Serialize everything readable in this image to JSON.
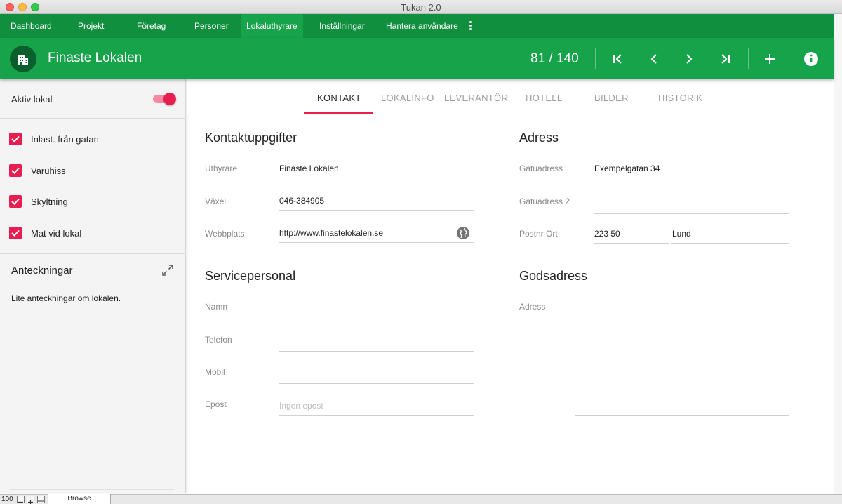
{
  "window": {
    "title": "Tukan 2.0"
  },
  "nav": {
    "items": [
      {
        "label": "Dashboard"
      },
      {
        "label": "Projekt"
      },
      {
        "label": "Företag"
      },
      {
        "label": "Personer"
      },
      {
        "label": "Lokaluthyrare",
        "active": true
      },
      {
        "label": "Inställningar"
      },
      {
        "label": "Hantera användare"
      }
    ],
    "more_icon": "more-vertical-icon"
  },
  "header": {
    "avatar_icon": "building-icon",
    "title": "Finaste Lokalen",
    "counter": "81 / 140",
    "buttons": [
      "first-page-icon",
      "previous-icon",
      "next-icon",
      "last-page-icon",
      "add-icon",
      "info-icon"
    ]
  },
  "sidebar": {
    "active_label": "Aktiv lokal",
    "active_on": true,
    "checkboxes": [
      {
        "label": "Inlast. från gatan",
        "checked": true
      },
      {
        "label": "Varuhiss",
        "checked": true
      },
      {
        "label": "Skyltning",
        "checked": true
      },
      {
        "label": "Mat vid lokal",
        "checked": true
      }
    ],
    "notes_title": "Anteckningar",
    "notes_text": "Lite anteckningar om lokalen."
  },
  "tabs": [
    {
      "label": "KONTAKT",
      "active": true
    },
    {
      "label": "LOKALINFO"
    },
    {
      "label": "LEVERANTÖR"
    },
    {
      "label": "HOTELL"
    },
    {
      "label": "BILDER"
    },
    {
      "label": "HISTORIK"
    }
  ],
  "contact": {
    "title": "Kontaktuppgifter",
    "landlord_label": "Uthyrare",
    "landlord_value": "Finaste Lokalen",
    "switchboard_label": "Växel",
    "switchboard_value": "046-384905",
    "website_label": "Webbplats",
    "website_value": "http://www.finastelokalen.se"
  },
  "service": {
    "title": "Servicepersonal",
    "name_label": "Namn",
    "name_value": "",
    "phone_label": "Telefon",
    "phone_value": "",
    "mobile_label": "Mobil",
    "mobile_value": "",
    "email_label": "Epost",
    "email_placeholder": "Ingen epost"
  },
  "address": {
    "title": "Adress",
    "street_label": "Gatuadress",
    "street_value": "Exempelgatan 34",
    "street2_label": "Gatuadress 2",
    "street2_value": "",
    "postal_label": "Postnr Ort",
    "postal_code": "223 50",
    "city": "Lund"
  },
  "goods": {
    "title": "Godsadress",
    "address_label": "Adress",
    "address_value": ""
  },
  "statusbar": {
    "zoom": "100",
    "mode": "Browse"
  },
  "colors": {
    "nav": "#10903f",
    "header": "#16a34a",
    "accent": "#e91e50"
  }
}
